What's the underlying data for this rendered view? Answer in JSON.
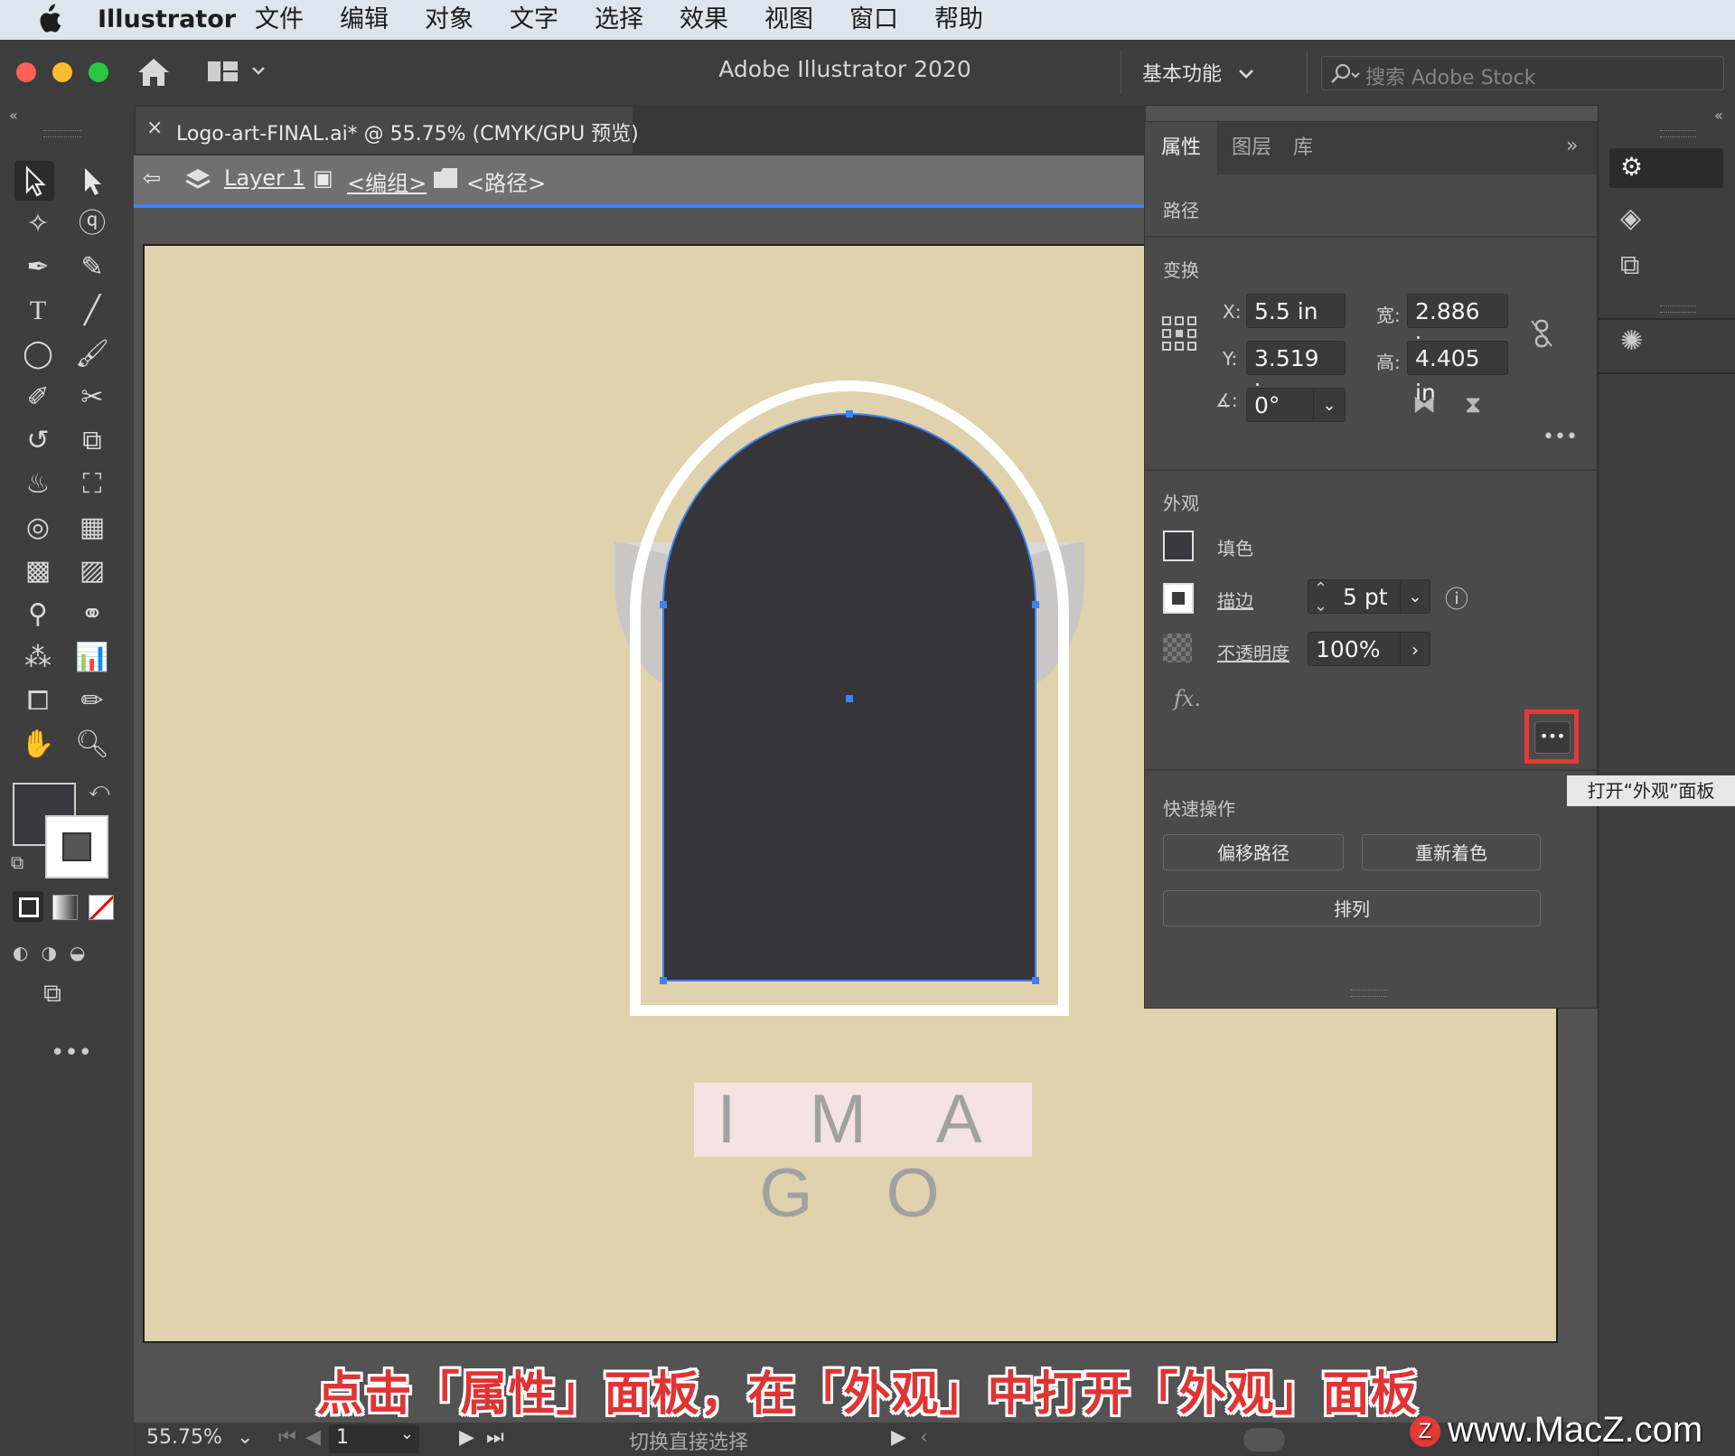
{
  "menubar": {
    "apple_icon": "apple-icon",
    "app_name": "Illustrator",
    "items": [
      "文件",
      "编辑",
      "对象",
      "文字",
      "选择",
      "效果",
      "视图",
      "窗口",
      "帮助"
    ]
  },
  "titlebar": {
    "title": "Adobe Illustrator 2020",
    "workspace": "基本功能",
    "search_placeholder": "搜索 Adobe Stock"
  },
  "document": {
    "tab_name": "Logo-art-FINAL.ai* @ 55.75% (CMYK/GPU 预览)",
    "close": "×"
  },
  "breadcrumb": {
    "layer": "Layer 1",
    "group": "<编组>",
    "path": "<路径>"
  },
  "artwork": {
    "logo_text": "I M A G O"
  },
  "panel": {
    "tabs": [
      "属性",
      "图层",
      "库"
    ],
    "selection_type": "路径",
    "transform": {
      "section": "变换",
      "x_label": "X:",
      "x": "5.5 in",
      "y_label": "Y:",
      "y": "3.519 in",
      "w_label": "宽:",
      "w": "2.886 in",
      "h_label": "高:",
      "h": "4.405 in",
      "angle": "0°"
    },
    "appearance": {
      "section": "外观",
      "fill_label": "填色",
      "stroke_label": "描边",
      "stroke_weight": "5 pt",
      "opacity_label": "不透明度",
      "opacity": "100%",
      "fx": "fx."
    },
    "quick_actions": {
      "section": "快速操作",
      "offset_path": "偏移路径",
      "recolor": "重新着色",
      "arrange": "排列"
    },
    "tooltip": "打开“外观”面板"
  },
  "status": {
    "zoom": "55.75%",
    "artboard": "1",
    "tool_hint": "切换直接选择"
  },
  "caption": "点击「属性」面板，在「外观」中打开「外观」面板",
  "watermark": "www.MacZ.com",
  "colors": {
    "accent": "#3f83f3",
    "highlight": "#e53935",
    "artboard": "#e0d2ad",
    "arch_fill": "#36363a"
  }
}
